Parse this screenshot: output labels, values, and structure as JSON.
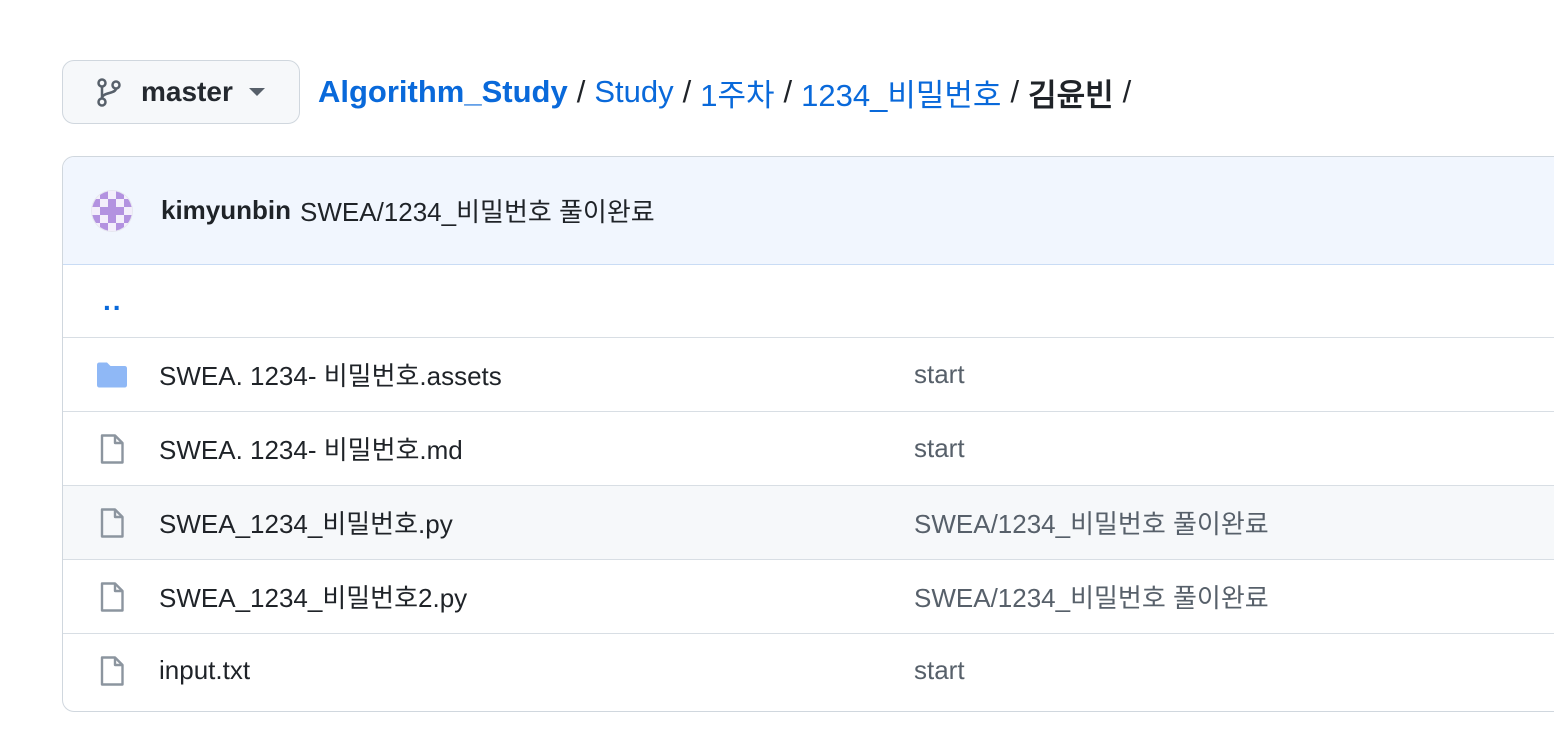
{
  "branch": {
    "name": "master"
  },
  "breadcrumb": {
    "repo": "Algorithm_Study",
    "parts": [
      "Study",
      "1주차",
      "1234_비밀번호"
    ],
    "current": "김윤빈",
    "separator": "/"
  },
  "latest_commit": {
    "author": "kimyunbin",
    "message": "SWEA/1234_비밀번호 풀이완료"
  },
  "parent_dir": "..",
  "files": [
    {
      "name": "SWEA. 1234- 비밀번호.assets",
      "type": "folder",
      "commit": "start"
    },
    {
      "name": "SWEA. 1234- 비밀번호.md",
      "type": "file",
      "commit": "start"
    },
    {
      "name": "SWEA_1234_비밀번호.py",
      "type": "file",
      "commit": "SWEA/1234_비밀번호 풀이완료"
    },
    {
      "name": "SWEA_1234_비밀번호2.py",
      "type": "file",
      "commit": "SWEA/1234_비밀번호 풀이완료"
    },
    {
      "name": "input.txt",
      "type": "file",
      "commit": "start"
    }
  ],
  "colors": {
    "link": "#0969da",
    "folder": "#8fb8f6",
    "file_icon": "#8c959f",
    "header_bg": "#f1f6fe",
    "avatar": "#b392e0"
  }
}
